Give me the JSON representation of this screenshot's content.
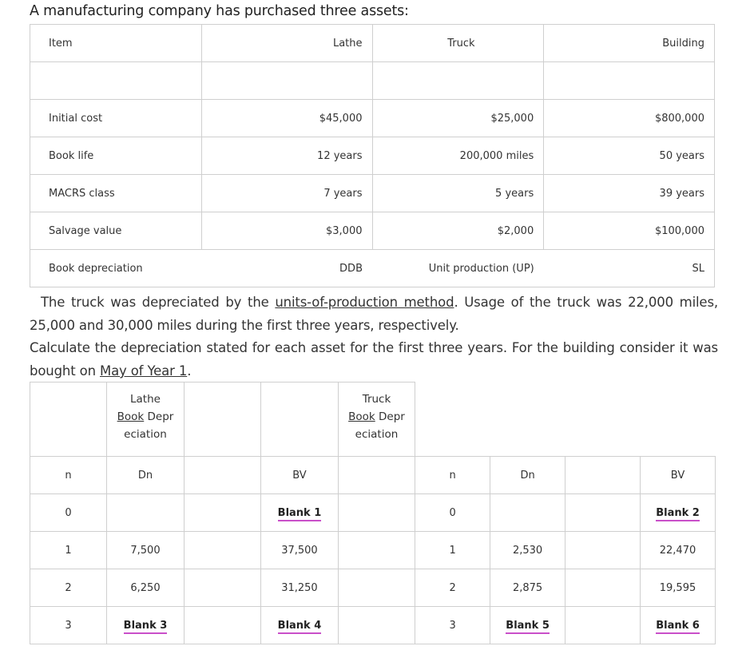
{
  "intro": "A manufacturing company has purchased three assets:",
  "assets_table": {
    "headers": [
      "Item",
      "Lathe",
      "Truck",
      "Building"
    ],
    "rows": [
      {
        "label": "Initial cost",
        "lathe": "$45,000",
        "truck": "$25,000",
        "building": "$800,000"
      },
      {
        "label": "Book life",
        "lathe": "12 years",
        "truck": "200,000 miles",
        "building": "50 years"
      },
      {
        "label": "MACRS class",
        "lathe": "7 years",
        "truck": "5 years",
        "building": "39 years"
      },
      {
        "label": "Salvage value",
        "lathe": "$3,000",
        "truck": "$2,000",
        "building": "$100,000"
      },
      {
        "label": "Book depreciation",
        "lathe": "DDB",
        "truck": "Unit production (UP)",
        "building": "SL"
      }
    ]
  },
  "paragraph1": {
    "before": "The truck was depreciated by the ",
    "link": "units-of-production method",
    "after": ". Usage of the truck was 22,000 miles, 25,000 and 30,000 miles during the first three years, respectively."
  },
  "paragraph2": {
    "before": "Calculate the depreciation stated for each asset for the first three years. For the building consider it was bought on ",
    "link": "May of Year 1",
    "after": "."
  },
  "depreciation_table": {
    "lathe_header": {
      "line1": "Lathe",
      "line2a": "Book",
      "line2b": " Depr",
      "line3": "eciation"
    },
    "truck_header": {
      "line1": "Truck",
      "line2a": "Book",
      "line2b": " Depr",
      "line3": "eciation"
    },
    "col_headers": {
      "n": "n",
      "dn": "Dn",
      "bv": "BV"
    },
    "rows": [
      {
        "n": "0",
        "lathe_dn": "",
        "lathe_bv": "Blank 1",
        "truck_n": "0",
        "truck_dn": "",
        "truck_bv": "Blank 2"
      },
      {
        "n": "1",
        "lathe_dn": "7,500",
        "lathe_bv": "37,500",
        "truck_n": "1",
        "truck_dn": "2,530",
        "truck_bv": "22,470"
      },
      {
        "n": "2",
        "lathe_dn": "6,250",
        "lathe_bv": "31,250",
        "truck_n": "2",
        "truck_dn": "2,875",
        "truck_bv": "19,595"
      },
      {
        "n": "3",
        "lathe_dn": "Blank 3",
        "lathe_bv": "Blank 4",
        "truck_n": "3",
        "truck_dn": "Blank 5",
        "truck_bv": "Blank 6"
      }
    ]
  },
  "colors": {
    "blank_underline": "#c94fc9",
    "border": "#cfcfcf"
  }
}
